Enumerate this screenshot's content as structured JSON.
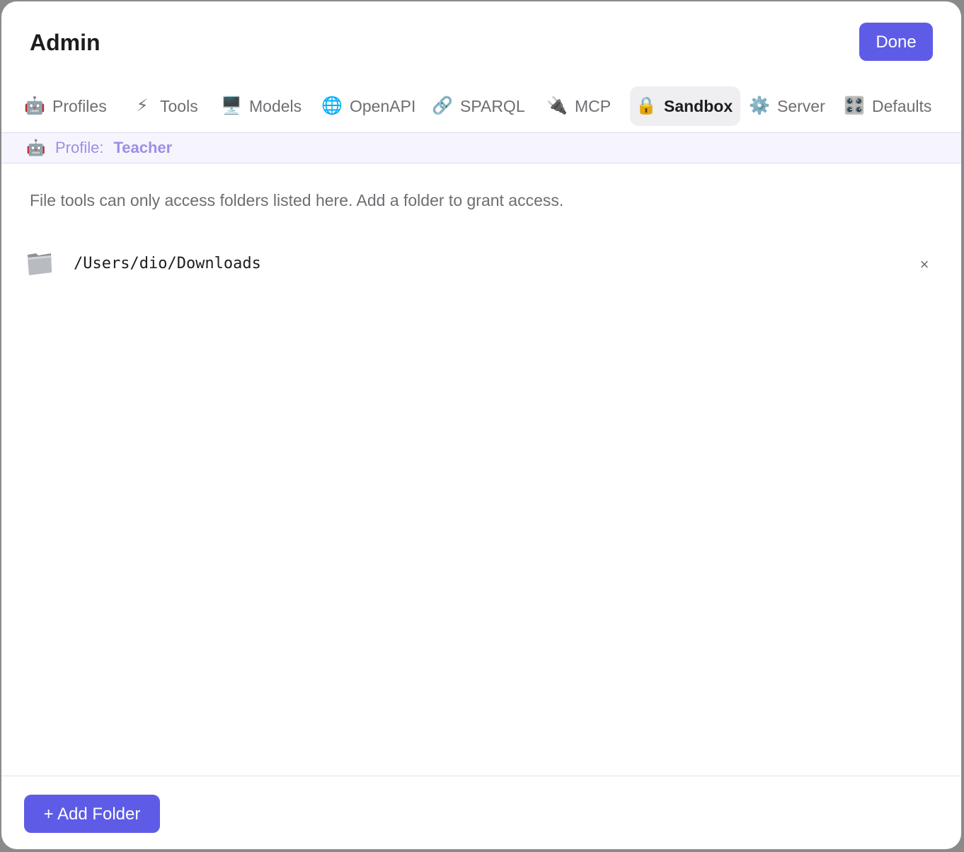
{
  "window": {
    "title": "Admin",
    "done_label": "Done"
  },
  "tabs": [
    {
      "icon": "robot-icon",
      "glyph": "🤖",
      "label": "Profiles",
      "active": false
    },
    {
      "icon": "lightning-icon",
      "glyph": "⚡",
      "label": "Tools",
      "active": false
    },
    {
      "icon": "monitor-icon",
      "glyph": "🖥️",
      "label": "Models",
      "active": false
    },
    {
      "icon": "globe-icon",
      "glyph": "🌐",
      "label": "OpenAPI",
      "active": false
    },
    {
      "icon": "link-icon",
      "glyph": "🔗",
      "label": "SPARQL",
      "active": false
    },
    {
      "icon": "plug-icon",
      "glyph": "🔌",
      "label": "MCP",
      "active": false
    },
    {
      "icon": "lock-icon",
      "glyph": "🔒",
      "label": "Sandbox",
      "active": true
    },
    {
      "icon": "gear-icon",
      "glyph": "⚙️",
      "label": "Server",
      "active": false
    },
    {
      "icon": "control-knobs-icon",
      "glyph": "🎛️",
      "label": "Defaults",
      "active": false
    }
  ],
  "profile": {
    "icon": "robot-icon",
    "glyph": "🤖",
    "label": "Profile:",
    "name": "Teacher"
  },
  "sandbox": {
    "description": "File tools can only access folders listed here. Add a folder to grant access.",
    "folders": [
      {
        "icon": "folder-icon",
        "path": "/Users/dio/Downloads",
        "remove_glyph": "×"
      }
    ],
    "add_label": "+ Add Folder"
  },
  "colors": {
    "accent": "#5e5ce6",
    "profile_text": "#9b8fe6",
    "profile_bg": "#f6f5fd",
    "active_tab_bg": "#efeff1"
  }
}
